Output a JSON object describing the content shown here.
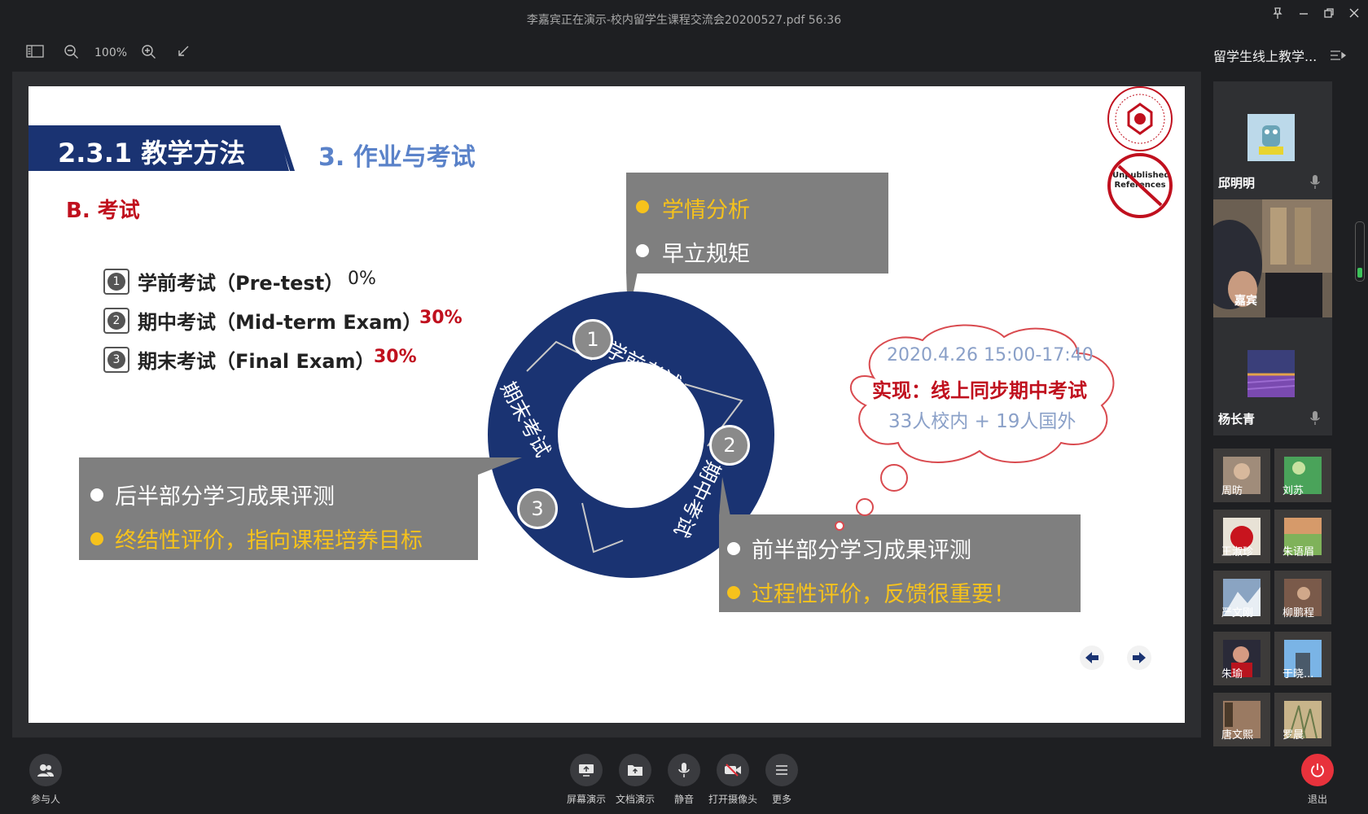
{
  "window": {
    "title": "李嘉宾正在演示-校内留学生课程交流会20200527.pdf 56:36"
  },
  "toolbar": {
    "zoom": "100%"
  },
  "slide": {
    "section": "2.3.1 教学方法",
    "subsection": "3. 作业与考试",
    "heading": "B. 考试",
    "exams": [
      {
        "num": "1",
        "label": "学前考试（Pre-test）",
        "pct": "0%"
      },
      {
        "num": "2",
        "label": "期中考试（Mid-term Exam）",
        "pct": "30%"
      },
      {
        "num": "3",
        "label": "期末考试（Final Exam）",
        "pct": "30%"
      }
    ],
    "ring": {
      "seg1": "学前考试",
      "seg2": "期中考试",
      "seg3": "期末考试",
      "n1": "1",
      "n2": "2",
      "n3": "3"
    },
    "box_top": {
      "line1": "学情分析",
      "line2": "早立规矩"
    },
    "box_left": {
      "line1": "后半部分学习成果评测",
      "line2": "终结性评价，指向课程培养目标"
    },
    "box_right": {
      "line1": "前半部分学习成果评测",
      "line2": "过程性评价，反馈很重要！"
    },
    "cloud": {
      "line1": "2020.4.26 15:00-17:40",
      "line2": "实现：线上同步期中考试",
      "line3": "33人校内 + 19人国外"
    },
    "stamp": "Unpublished References",
    "colors": {
      "navy": "#1a3372",
      "gray": "#7f7f7f",
      "yellow": "#f6c21c",
      "red": "#c0101e"
    }
  },
  "panel": {
    "title": "留学生线上教学...",
    "big": [
      {
        "name": "邱明明"
      },
      {
        "name": "嘉宾"
      },
      {
        "name": "杨长青"
      }
    ],
    "small": [
      "周昉",
      "刘苏",
      "王淑珍",
      "朱语眉",
      "严文刚",
      "柳鹏程",
      "朱瑜",
      "于晓...",
      "唐文熙",
      "罗晨"
    ]
  },
  "bottom": {
    "participants": "参与人",
    "screen": "屏幕演示",
    "doc": "文档演示",
    "mute": "静音",
    "camera": "打开摄像头",
    "more": "更多",
    "exit": "退出"
  }
}
